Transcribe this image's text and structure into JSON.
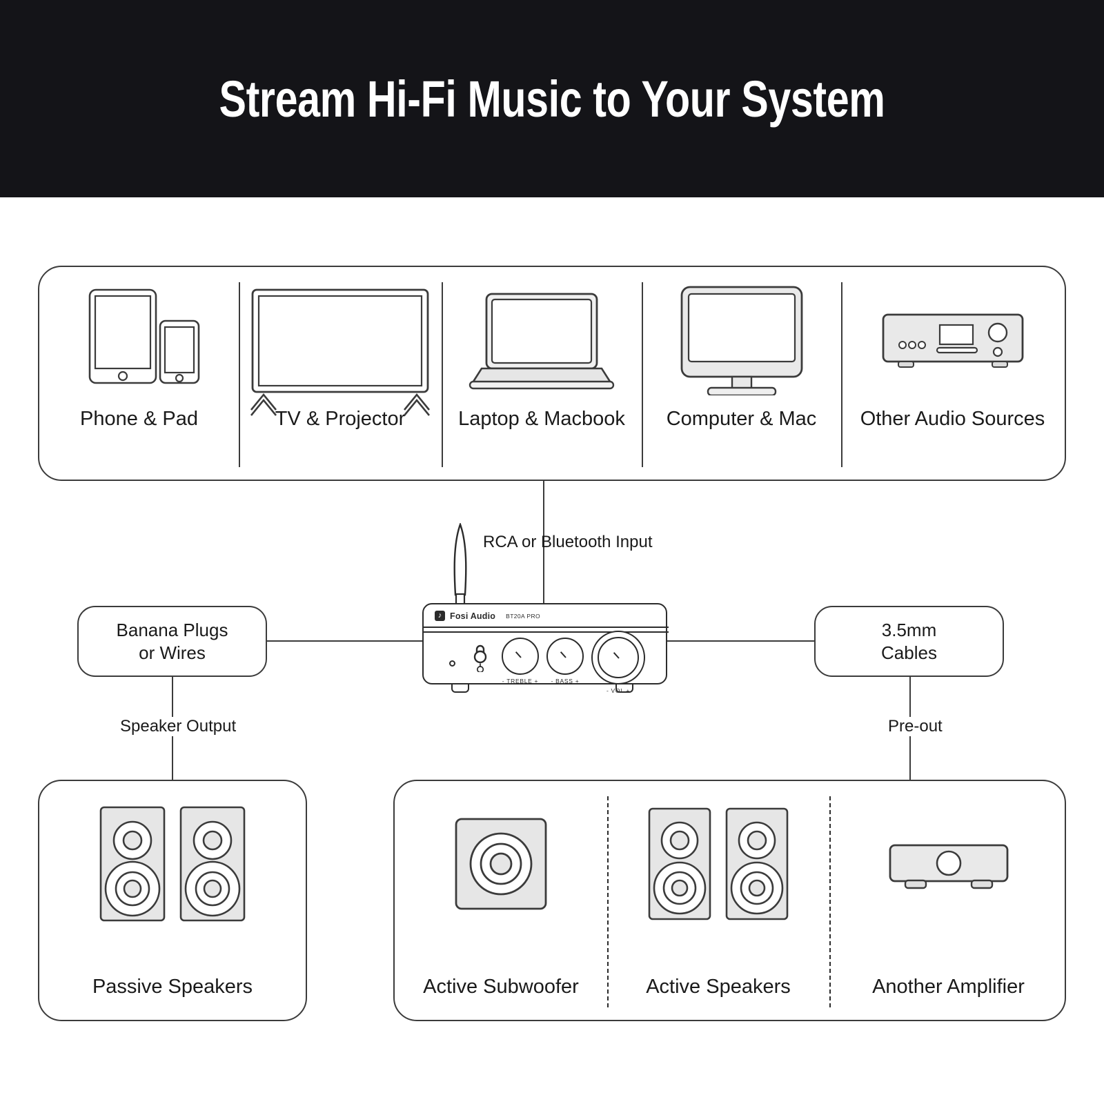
{
  "header": {
    "title": "Stream Hi-Fi Music to Your System",
    "bg": "#141418",
    "fg": "#ffffff"
  },
  "sources": {
    "items": [
      {
        "label": "Phone & Pad",
        "icon": "tablet-phone-icon"
      },
      {
        "label": "TV & Projector",
        "icon": "television-icon"
      },
      {
        "label": "Laptop & Macbook",
        "icon": "laptop-icon"
      },
      {
        "label": "Computer & Mac",
        "icon": "desktop-monitor-icon"
      },
      {
        "label": "Other Audio Sources",
        "icon": "stereo-receiver-icon"
      }
    ]
  },
  "amplifier": {
    "brand": "Fosi Audio",
    "model": "BT20A PRO",
    "logo_glyph": "♪",
    "knobs": [
      {
        "label": "- TREBLE +",
        "name": "treble-knob"
      },
      {
        "label": "- BASS +",
        "name": "bass-knob"
      },
      {
        "label": "- VOL +",
        "name": "volume-knob"
      }
    ],
    "power_label": "power-switch",
    "led_label": "status-led"
  },
  "connections": {
    "input_label": "RCA or Bluetooth Input",
    "speaker_output_label": "Speaker Output",
    "preout_label": "Pre-out"
  },
  "accessories": {
    "left": {
      "label": "Banana Plugs\nor Wires"
    },
    "right": {
      "label": "3.5mm\nCables"
    }
  },
  "outputs": {
    "passive": {
      "label": "Passive Speakers",
      "icon": "passive-speaker-pair-icon"
    },
    "items": [
      {
        "label": "Active Subwoofer",
        "icon": "subwoofer-icon"
      },
      {
        "label": "Active Speakers",
        "icon": "active-speaker-pair-icon"
      },
      {
        "label": "Another Amplifier",
        "icon": "amplifier-icon"
      }
    ]
  },
  "colors": {
    "stroke": "#3b3b3b",
    "stroke_dark": "#2b2b2b",
    "icon_fill": "#e6e6e6",
    "background": "#ffffff",
    "text": "#1a1a1a"
  }
}
